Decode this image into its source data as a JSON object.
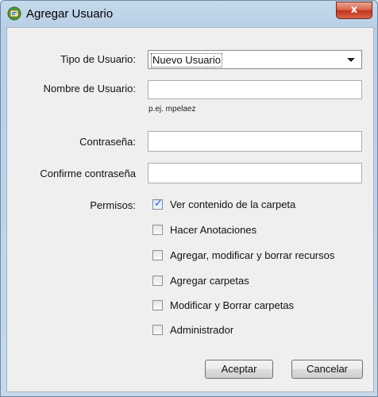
{
  "window": {
    "title": "Agregar Usuario",
    "close_glyph": "x"
  },
  "form": {
    "user_type": {
      "label": "Tipo de Usuario:",
      "selected": "Nuevo Usuario"
    },
    "username": {
      "label": "Nombre de Usuario:",
      "value": "",
      "hint": "p.ej. mpelaez"
    },
    "password": {
      "label": "Contraseña:",
      "value": ""
    },
    "confirm_password": {
      "label": "Confirme contraseña",
      "value": ""
    },
    "permissions": {
      "label": "Permisos:",
      "items": [
        {
          "label": "Ver contenido de la carpeta",
          "checked": true
        },
        {
          "label": "Hacer Anotaciones",
          "checked": false
        },
        {
          "label": "Agregar, modificar y borrar recursos",
          "checked": false
        },
        {
          "label": "Agregar carpetas",
          "checked": false
        },
        {
          "label": "Modificar y Borrar carpetas",
          "checked": false
        },
        {
          "label": "Administrador",
          "checked": false
        }
      ]
    }
  },
  "buttons": {
    "accept": "Aceptar",
    "cancel": "Cancelar"
  },
  "checkmark_glyph": "✓"
}
